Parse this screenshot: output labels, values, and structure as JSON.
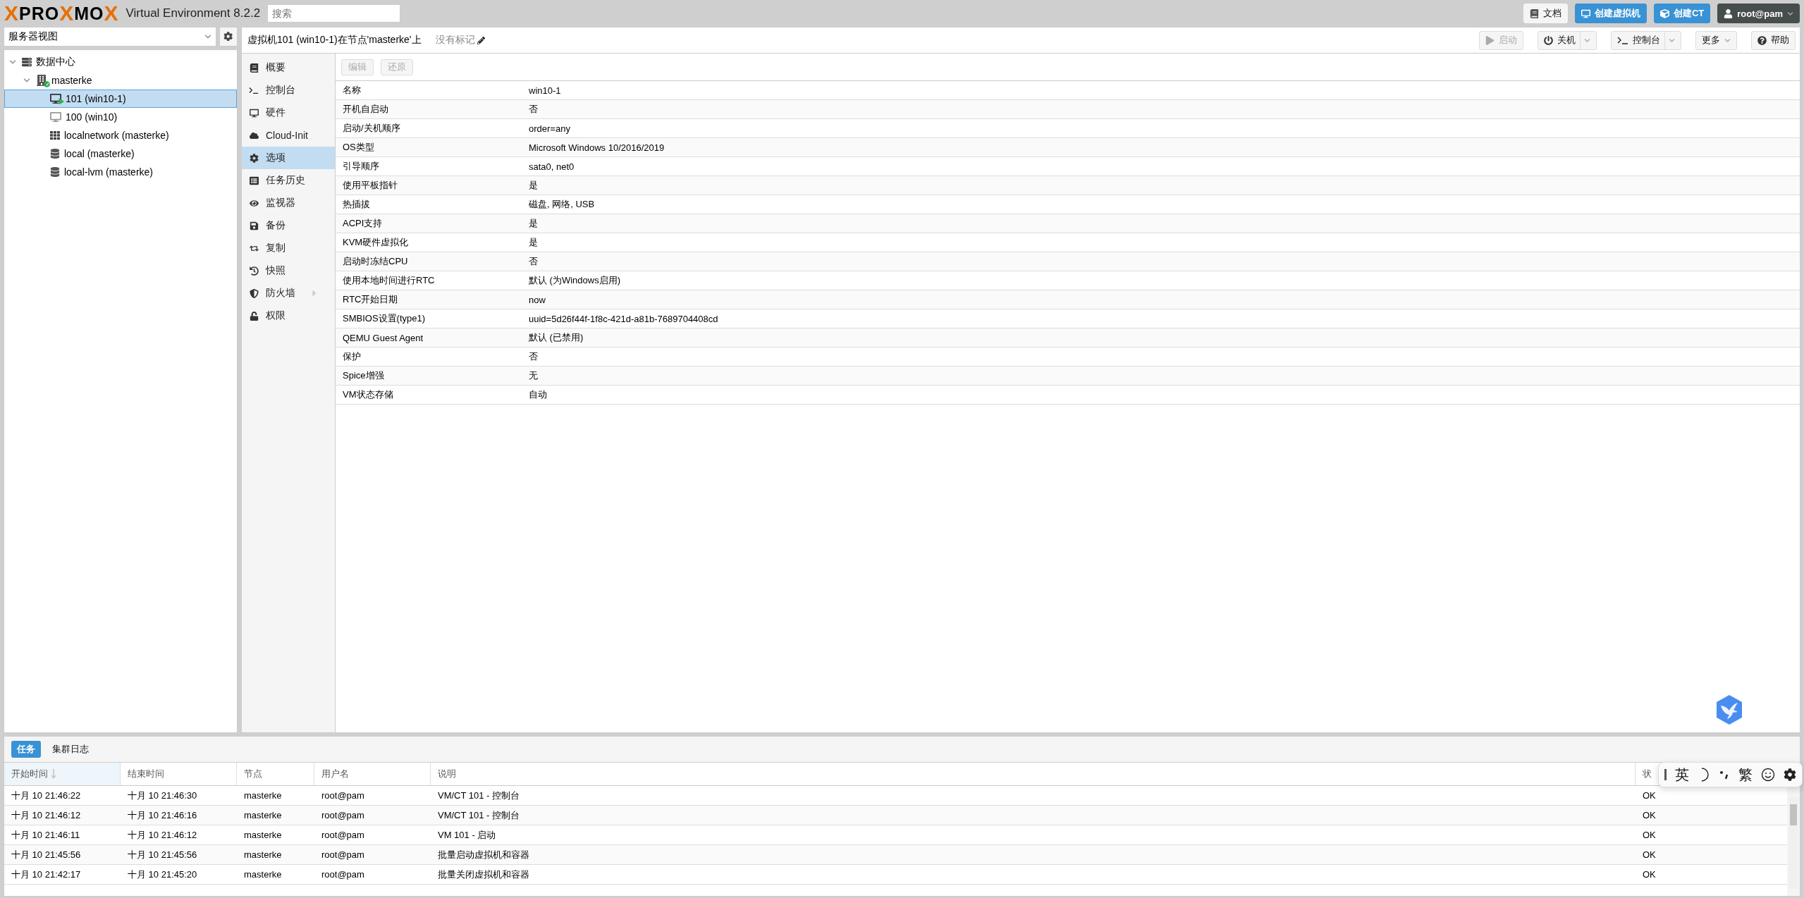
{
  "header": {
    "logo_parts": [
      {
        "text": "X",
        "accent": true
      },
      {
        "text": "PRO",
        "accent": false
      },
      {
        "text": "X",
        "accent": true
      },
      {
        "text": "MO",
        "accent": false
      },
      {
        "text": "X",
        "accent": true
      }
    ],
    "product": "Virtual Environment 8.2.2",
    "search": {
      "placeholder": "搜索"
    },
    "buttons": [
      {
        "label": "文档",
        "kind": "docs"
      },
      {
        "label": "创建虚拟机",
        "kind": "create-vm"
      },
      {
        "label": "创建CT",
        "kind": "create-ct"
      },
      {
        "label": "root@pam",
        "kind": "user"
      }
    ]
  },
  "sidebar": {
    "view_select": {
      "value": "服务器视图"
    },
    "tree": [
      {
        "label": "数据中心",
        "kind": "datacenter",
        "expanded": true,
        "selected": false,
        "children": [
          {
            "label": "masterke",
            "kind": "node",
            "expanded": true,
            "selected": false,
            "children": [
              {
                "label": "101 (win10-1)",
                "kind": "vm-running",
                "selected": true
              },
              {
                "label": "100 (win10)",
                "kind": "vm-stopped",
                "selected": false
              },
              {
                "label": "localnetwork (masterke)",
                "kind": "network",
                "selected": false
              },
              {
                "label": "local (masterke)",
                "kind": "storage",
                "selected": false
              },
              {
                "label": "local-lvm (masterke)",
                "kind": "storage",
                "selected": false
              }
            ]
          }
        ]
      }
    ]
  },
  "content": {
    "title": "虚拟机101 (win10-1)在节点'masterke'上",
    "tags": "没有标记",
    "actions": [
      {
        "label": "启动",
        "kind": "start",
        "disabled": true,
        "split": false
      },
      {
        "label": "关机",
        "kind": "shutdown",
        "disabled": false,
        "split": true
      },
      {
        "label": "控制台",
        "kind": "console",
        "disabled": false,
        "split": true
      },
      {
        "label": "更多",
        "kind": "more",
        "disabled": false,
        "split": false
      },
      {
        "label": "帮助",
        "kind": "help",
        "disabled": false,
        "split": false
      }
    ],
    "menu": [
      {
        "label": "概要",
        "selected": false,
        "submenu": false
      },
      {
        "label": "控制台",
        "selected": false,
        "submenu": false
      },
      {
        "label": "硬件",
        "selected": false,
        "submenu": false
      },
      {
        "label": "Cloud-Init",
        "selected": false,
        "submenu": false
      },
      {
        "label": "选项",
        "selected": true,
        "submenu": false
      },
      {
        "label": "任务历史",
        "selected": false,
        "submenu": false
      },
      {
        "label": "监视器",
        "selected": false,
        "submenu": false
      },
      {
        "label": "备份",
        "selected": false,
        "submenu": false
      },
      {
        "label": "复制",
        "selected": false,
        "submenu": false
      },
      {
        "label": "快照",
        "selected": false,
        "submenu": false
      },
      {
        "label": "防火墙",
        "selected": false,
        "submenu": true
      },
      {
        "label": "权限",
        "selected": false,
        "submenu": false
      }
    ],
    "toolbar": [
      {
        "label": "编辑",
        "disabled": true
      },
      {
        "label": "还原",
        "disabled": true
      }
    ],
    "options": [
      {
        "name": "名称",
        "value": "win10-1"
      },
      {
        "name": "开机自启动",
        "value": "否"
      },
      {
        "name": "启动/关机顺序",
        "value": "order=any"
      },
      {
        "name": "OS类型",
        "value": "Microsoft Windows 10/2016/2019"
      },
      {
        "name": "引导顺序",
        "value": "sata0, net0"
      },
      {
        "name": "使用平板指针",
        "value": "是"
      },
      {
        "name": "热插拔",
        "value": "磁盘, 网络, USB"
      },
      {
        "name": "ACPI支持",
        "value": "是"
      },
      {
        "name": "KVM硬件虚拟化",
        "value": "是"
      },
      {
        "name": "启动时冻结CPU",
        "value": "否"
      },
      {
        "name": "使用本地时间进行RTC",
        "value": "默认 (为Windows启用)"
      },
      {
        "name": "RTC开始日期",
        "value": "now"
      },
      {
        "name": "SMBIOS设置(type1)",
        "value": "uuid=5d26f44f-1f8c-421d-a81b-7689704408cd"
      },
      {
        "name": "QEMU Guest Agent",
        "value": "默认 (已禁用)"
      },
      {
        "name": "保护",
        "value": "否"
      },
      {
        "name": "Spice增强",
        "value": "无"
      },
      {
        "name": "VM状态存储",
        "value": "自动"
      }
    ]
  },
  "log_panel": {
    "tabs": [
      {
        "label": "任务",
        "selected": true
      },
      {
        "label": "集群日志",
        "selected": false
      }
    ],
    "columns": [
      {
        "label": "开始时间",
        "sorted": true
      },
      {
        "label": "结束时间",
        "sorted": false
      },
      {
        "label": "节点",
        "sorted": false
      },
      {
        "label": "用户名",
        "sorted": false
      },
      {
        "label": "说明",
        "sorted": false
      },
      {
        "label": "状",
        "sorted": false
      }
    ],
    "rows": [
      [
        "十月 10 21:46:22",
        "十月 10 21:46:30",
        "masterke",
        "root@pam",
        "VM/CT 101 - 控制台",
        "OK"
      ],
      [
        "十月 10 21:46:12",
        "十月 10 21:46:16",
        "masterke",
        "root@pam",
        "VM/CT 101 - 控制台",
        "OK"
      ],
      [
        "十月 10 21:46:11",
        "十月 10 21:46:12",
        "masterke",
        "root@pam",
        "VM 101 - 启动",
        "OK"
      ],
      [
        "十月 10 21:45:56",
        "十月 10 21:45:56",
        "masterke",
        "root@pam",
        "批量启动虚拟机和容器",
        "OK"
      ],
      [
        "十月 10 21:42:17",
        "十月 10 21:45:20",
        "masterke",
        "root@pam",
        "批量关闭虚拟机和容器",
        "OK"
      ]
    ]
  },
  "ime_toolbar": {
    "language": "英",
    "script": "繁"
  }
}
